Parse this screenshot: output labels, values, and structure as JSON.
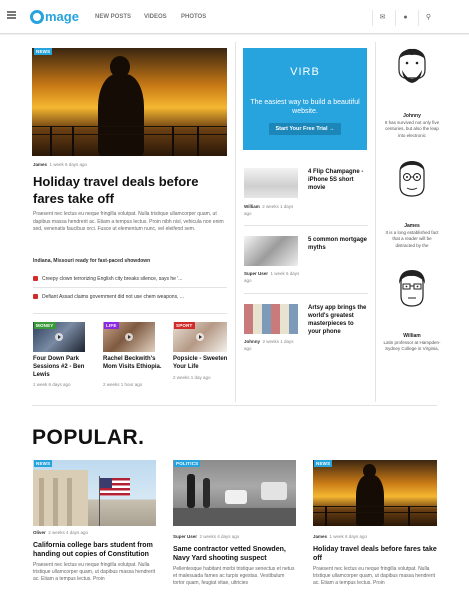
{
  "header": {
    "logo_text": "mage",
    "nav": [
      "NEW POSTS",
      "VIDEOS",
      "PHOTOS"
    ],
    "icons": [
      "share-icon",
      "user-icon",
      "search-icon"
    ]
  },
  "featured": {
    "badge": "NEWS",
    "author": "James",
    "time": "1 week 6 days ago",
    "title": "Holiday travel deals before fares take off",
    "body": "Praesent nec lectus eu neque fringilla volutpat. Nulla tristique ullamcorper quam, ut dapibus massa hendrerit ac. Etiam a tempus lectus. Proin nibh nisl, vehicula non enim sed, venenatis faucibus orci. Fusce ut elementum nunc, vel eleifend sem.",
    "related_heading": "Indiana, Missouri ready for fast-paced showdown",
    "related": [
      "Creepy clown terrorizing English city breaks silence, says he '...",
      "Defiant Assad claims government did not use chem weapons, ..."
    ]
  },
  "small_posts": [
    {
      "badge": "MONEY",
      "title": "Four Down Park Sessions #2 - Ben Lewis",
      "time": "1 week 6 days ago"
    },
    {
      "badge": "LIFE",
      "title": "Rachel Beckwith's Mom Visits Ethiopia.",
      "time": "2 weeks 1 hour ago"
    },
    {
      "badge": "SPORT",
      "title": "Popsicle - Sweeten Your Life",
      "time": "2 weeks 1 day ago"
    }
  ],
  "ad": {
    "logo": "VIRB",
    "text": "The easiest way to build a beautiful website.",
    "button": "Start Your Free Trial →"
  },
  "side_posts": [
    {
      "title": "4 Flip Champagne - iPhone 5S short movie",
      "author": "William",
      "time": "2 weeks 1 days ago"
    },
    {
      "title": "5 common mortgage myths",
      "author": "Super User",
      "time": "1 week 6 days ago"
    },
    {
      "title": "Artsy app brings the world's greatest masterpieces to your phone",
      "author": "Johnny",
      "time": "2 weeks 1 days ago"
    }
  ],
  "authors": [
    {
      "name": "Johnny",
      "bio": "It has survived not only five centuries, but also the leap into electronic"
    },
    {
      "name": "James",
      "bio": "It is a long established fact that a reader will be distracted by the"
    },
    {
      "name": "William",
      "bio": "Latin professor at Hampden-Sydney College in Virginia,"
    }
  ],
  "popular": {
    "heading": "POPULAR.",
    "cards": [
      {
        "badge": "NEWS",
        "author": "Oliver",
        "time": "2 weeks 4 days ago",
        "title": "California college bars student from handing out copies of Constitution",
        "body": "Praesent nec lectus eu neque fringilla volutpat. Nulla tristique ullamcorper quam, ut dapibus massa hendrerit ac. Etiam a tempus lectus. Proin"
      },
      {
        "badge": "POLITICS",
        "author": "Super User",
        "time": "2 weeks 4 days ago",
        "title": "Same contractor vetted Snowden, Navy Yard shooting suspect",
        "body": "Pellentesque habitant morbi tristique senectus et netus et malesuada fames ac turpis egestas. Vestibulum tortor quam, feugiat vitae, ultricies"
      },
      {
        "badge": "NEWS",
        "author": "James",
        "time": "1 week 6 days ago",
        "title": "Holiday travel deals before fares take off",
        "body": "Praesent nec lectus eu neque fringilla volutpat. Nulla tristique ullamcorper quam, ut dapibus massa hendrerit ac. Etiam a tempus lectus. Proin"
      }
    ]
  }
}
